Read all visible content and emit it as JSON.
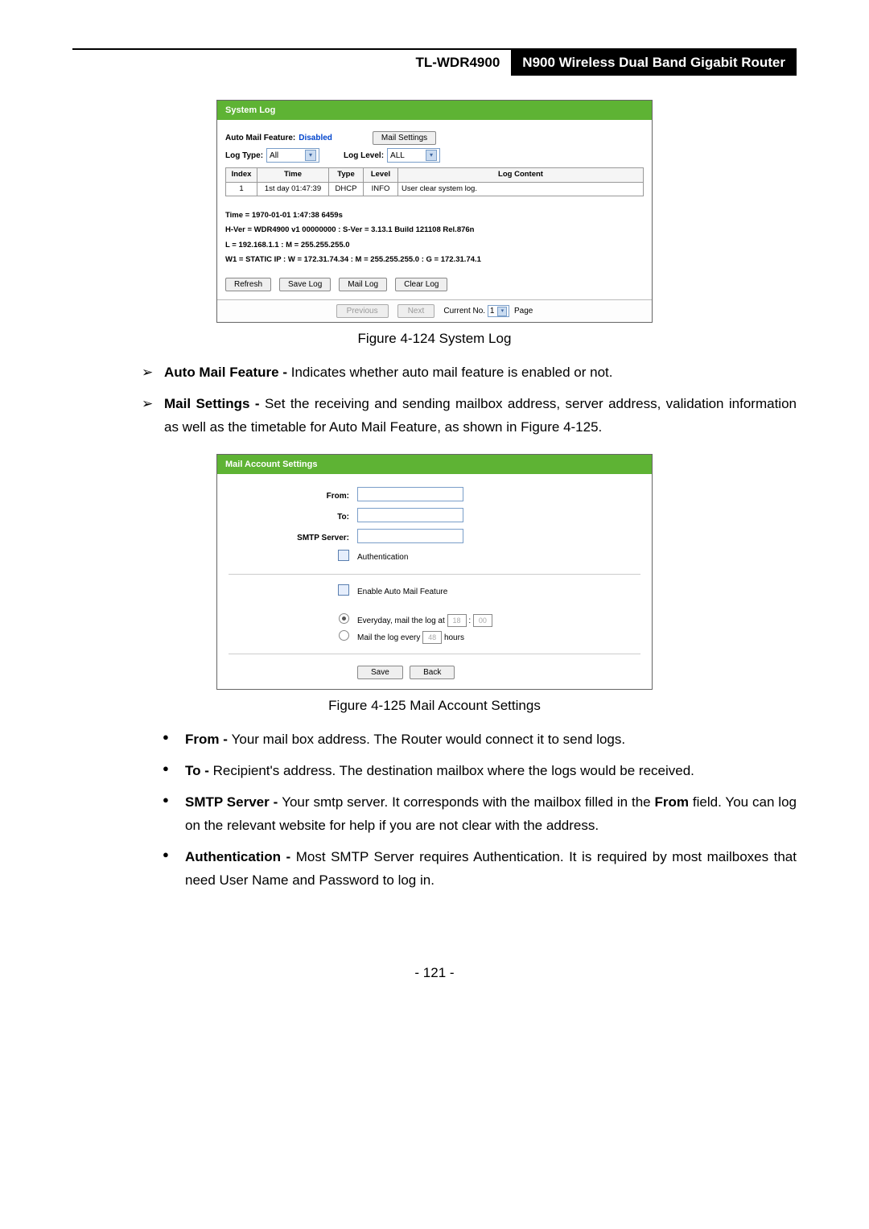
{
  "header": {
    "model": "TL-WDR4900",
    "product": "N900 Wireless Dual Band Gigabit Router"
  },
  "syslog": {
    "title": "System Log",
    "automail_lbl": "Auto Mail Feature:",
    "automail_val": "Disabled",
    "mail_settings_btn": "Mail Settings",
    "logtype_lbl": "Log Type:",
    "logtype_val": "All",
    "loglevel_lbl": "Log Level:",
    "loglevel_val": "ALL",
    "th": {
      "index": "Index",
      "time": "Time",
      "type": "Type",
      "level": "Level",
      "content": "Log Content"
    },
    "row": {
      "index": "1",
      "time": "1st day 01:47:39",
      "type": "DHCP",
      "level": "INFO",
      "content": "User clear system log."
    },
    "info": {
      "time": "Time = 1970-01-01 1:47:38 6459s",
      "hver": "H-Ver = WDR4900 v1 00000000 : S-Ver = 3.13.1 Build 121108 Rel.876n",
      "lan": "L = 192.168.1.1 : M = 255.255.255.0",
      "wan": "W1 = STATIC IP : W = 172.31.74.34 : M = 255.255.255.0 : G = 172.31.74.1"
    },
    "btns": {
      "refresh": "Refresh",
      "savelog": "Save Log",
      "maillog": "Mail Log",
      "clearlog": "Clear Log"
    },
    "pager": {
      "prev": "Previous",
      "next": "Next",
      "curr_lbl": "Current No.",
      "curr_val": "1",
      "page": "Page"
    }
  },
  "cap1": "Figure 4-124 System Log",
  "arrows": {
    "a1b": "Auto Mail Feature - ",
    "a1t": "Indicates whether auto mail feature is enabled or not.",
    "a2b": "Mail Settings - ",
    "a2t": "Set the receiving and sending mailbox address, server address, validation information as well as the timetable for Auto Mail Feature, as shown in Figure 4-125."
  },
  "mail": {
    "title": "Mail Account Settings",
    "from": "From:",
    "to": "To:",
    "smtp": "SMTP Server:",
    "auth": "Authentication",
    "enable": "Enable Auto Mail Feature",
    "everyday_a": "Everyday, mail the log at",
    "hh": "18",
    "colon": ":",
    "mm": "00",
    "every_a": "Mail the log every",
    "every_val": "48",
    "hours": "hours",
    "save": "Save",
    "back": "Back"
  },
  "cap2": "Figure 4-125 Mail Account Settings",
  "dots": {
    "d1b": "From - ",
    "d1t": "Your mail box address. The Router would connect it to send logs.",
    "d2b": "To - ",
    "d2t": "Recipient's address. The destination mailbox where the logs would be received.",
    "d3b": "SMTP Server - ",
    "d3t1": "Your smtp server. It corresponds with the mailbox filled in the ",
    "d3b2": "From",
    "d3t2": " field. You can log on the relevant website for help if you are not clear with the address.",
    "d4b": "Authentication - ",
    "d4t": "Most SMTP Server requires Authentication. It is required by most mailboxes that need User Name and Password to log in."
  },
  "pagenum": "- 121 -"
}
